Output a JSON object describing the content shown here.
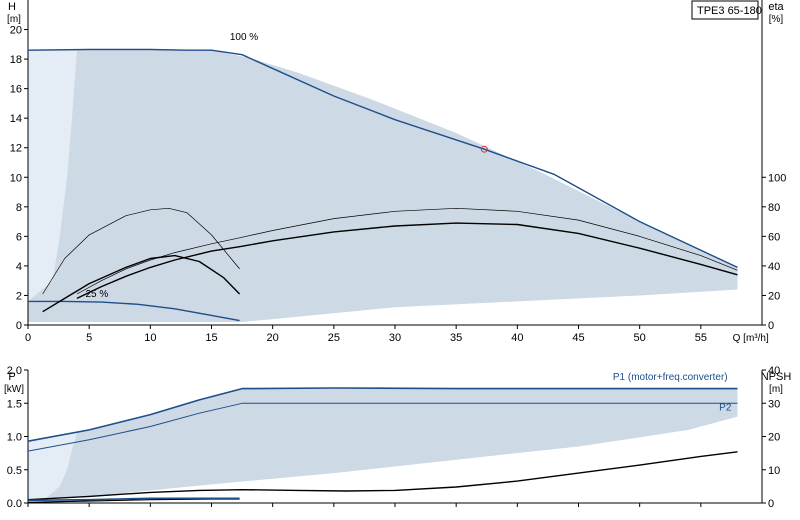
{
  "colors": {
    "operating_area": "#cdd9e4",
    "operating_area_light": "#e4edf5",
    "curve_blue": "#1f4e8a",
    "curve_black": "#000000",
    "axis": "#000000",
    "marker": "#e03030"
  },
  "model_label": "TPE3 65-180",
  "chart_data": [
    {
      "type": "line",
      "id": "top",
      "ylabel_left": "H",
      "yunit_left": "[m]",
      "ylabel_right": "eta",
      "yunit_right": "[%]",
      "xlabel": "Q [m³/h]",
      "xlim": [
        0,
        60
      ],
      "ylim": [
        0,
        22
      ],
      "x_ticks": [
        "0",
        "5",
        "10",
        "15",
        "20",
        "25",
        "30",
        "35",
        "40",
        "45",
        "50",
        "55"
      ],
      "y_ticks_left": [
        "0",
        "2",
        "4",
        "6",
        "8",
        "10",
        "12",
        "14",
        "16",
        "18",
        "20"
      ],
      "y_ticks_right": [
        "0",
        "20",
        "40",
        "60",
        "80",
        "100"
      ],
      "eta_scale_max_at_H": 10,
      "operating_area": [
        [
          0,
          18.6
        ],
        [
          15,
          18.6
        ],
        [
          18,
          18.1
        ],
        [
          22,
          17.1
        ],
        [
          28,
          15.3
        ],
        [
          35,
          13
        ],
        [
          42,
          10.3
        ],
        [
          50,
          7
        ],
        [
          58,
          3.9
        ],
        [
          58,
          2.4
        ],
        [
          50,
          2
        ],
        [
          40,
          1.6
        ],
        [
          30,
          1.2
        ],
        [
          25,
          0.8
        ],
        [
          20,
          0.4
        ],
        [
          17.5,
          0.2
        ],
        [
          0,
          0.2
        ]
      ],
      "light_area": [
        [
          0,
          18.6
        ],
        [
          4,
          18.6
        ],
        [
          3.6,
          14
        ],
        [
          3.2,
          10
        ],
        [
          2.6,
          6
        ],
        [
          2,
          3
        ],
        [
          0,
          1.6
        ]
      ],
      "series": [
        {
          "name": "100 %",
          "color": "blue",
          "x": [
            0,
            5,
            10,
            13,
            15,
            17.5,
            25,
            30,
            37.3,
            43,
            50,
            58
          ],
          "y": [
            18.6,
            18.65,
            18.65,
            18.6,
            18.6,
            18.3,
            15.5,
            13.9,
            11.9,
            10.2,
            7,
            3.9
          ]
        },
        {
          "name": "25 %",
          "color": "blue",
          "x": [
            0,
            3,
            6,
            9,
            12,
            15,
            17.3
          ],
          "y": [
            1.6,
            1.6,
            1.55,
            1.4,
            1.1,
            0.65,
            0.3
          ]
        },
        {
          "name": "",
          "color": "black",
          "width": 1.4,
          "x": [
            1.2,
            3,
            5,
            8,
            10,
            12,
            14,
            16,
            17.3
          ],
          "y": [
            0.9,
            1.8,
            2.8,
            3.9,
            4.5,
            4.7,
            4.3,
            3.2,
            2.1
          ]
        },
        {
          "name": "",
          "color": "black",
          "width": 0.7,
          "x": [
            1.2,
            3,
            5,
            8,
            10,
            11.5,
            13,
            15,
            17.3
          ],
          "y": [
            2.1,
            4.5,
            6.1,
            7.4,
            7.8,
            7.9,
            7.6,
            6.1,
            3.8
          ]
        },
        {
          "name": "",
          "color": "black",
          "width": 1.4,
          "x": [
            4,
            6,
            8,
            10,
            12,
            15,
            17.3,
            20,
            25,
            30,
            35,
            40,
            45,
            50,
            55,
            58
          ],
          "y": [
            1.8,
            2.6,
            3.3,
            3.9,
            4.4,
            5.0,
            5.3,
            5.7,
            6.3,
            6.7,
            6.9,
            6.8,
            6.2,
            5.2,
            4.1,
            3.4
          ]
        },
        {
          "name": "",
          "color": "black",
          "width": 0.7,
          "x": [
            4,
            6,
            8,
            10,
            12,
            15,
            17.3,
            20,
            25,
            30,
            35,
            40,
            45,
            50,
            55,
            58
          ],
          "y": [
            2.1,
            3.0,
            3.8,
            4.4,
            4.9,
            5.5,
            5.9,
            6.4,
            7.2,
            7.7,
            7.9,
            7.7,
            7.1,
            6.0,
            4.7,
            3.7
          ]
        }
      ],
      "marker": {
        "x": 37.3,
        "y": 11.9
      },
      "annotations": [
        {
          "text": "100 %",
          "x": 16.5,
          "y": 19.3
        },
        {
          "text": "25 %",
          "x": 4.7,
          "y": 1.9
        }
      ]
    },
    {
      "type": "line",
      "id": "bottom",
      "ylabel_left": "P",
      "yunit_left": "[kW]",
      "ylabel_right": "NPSH",
      "yunit_right": "[m]",
      "xlim": [
        0,
        60
      ],
      "ylim": [
        0,
        2.0
      ],
      "y_ticks_left": [
        "0.0",
        "0.5",
        "1.0",
        "1.5",
        "2.0"
      ],
      "y_ticks_right": [
        "0",
        "10",
        "20",
        "30",
        "40"
      ],
      "npsh_scale_max_at_P": 2.0,
      "operating_area": [
        [
          0,
          0.93
        ],
        [
          5,
          1.1
        ],
        [
          10,
          1.32
        ],
        [
          14,
          1.55
        ],
        [
          17.5,
          1.72
        ],
        [
          30,
          1.72
        ],
        [
          58,
          1.72
        ],
        [
          58,
          1.3
        ],
        [
          54,
          1.1
        ],
        [
          45,
          0.85
        ],
        [
          35,
          0.65
        ],
        [
          25,
          0.45
        ],
        [
          15,
          0.28
        ],
        [
          5,
          0.1
        ],
        [
          0,
          0.05
        ]
      ],
      "light_area": [
        [
          0,
          0.93
        ],
        [
          4,
          1.05
        ],
        [
          3.6,
          0.8
        ],
        [
          3.2,
          0.5
        ],
        [
          2.6,
          0.25
        ],
        [
          1.5,
          0.08
        ],
        [
          0,
          0.05
        ]
      ],
      "series": [
        {
          "name": "P1 (motor+freq.converter)",
          "color": "blue",
          "width": 1.6,
          "x": [
            0,
            5,
            10,
            14,
            17.5,
            25,
            35,
            45,
            58
          ],
          "y": [
            0.93,
            1.1,
            1.33,
            1.55,
            1.72,
            1.73,
            1.72,
            1.72,
            1.72
          ]
        },
        {
          "name": "P2",
          "color": "blue",
          "width": 1,
          "x": [
            0,
            5,
            10,
            14,
            17.5,
            25,
            35,
            45,
            58
          ],
          "y": [
            0.78,
            0.95,
            1.15,
            1.35,
            1.5,
            1.5,
            1.5,
            1.5,
            1.5
          ]
        },
        {
          "name": "",
          "color": "black",
          "width": 1.4,
          "x": [
            0,
            5,
            10,
            14,
            17.5,
            22,
            26,
            30,
            35,
            40,
            45,
            50,
            55,
            58
          ],
          "y": [
            0.05,
            0.1,
            0.16,
            0.19,
            0.2,
            0.19,
            0.18,
            0.19,
            0.24,
            0.33,
            0.45,
            0.57,
            0.7,
            0.77
          ]
        },
        {
          "name": "",
          "color": "black",
          "width": 1.2,
          "x": [
            0,
            5,
            10,
            15,
            17.3
          ],
          "y": [
            0.01,
            0.03,
            0.05,
            0.06,
            0.06
          ]
        },
        {
          "name": "",
          "color": "blue",
          "width": 1.6,
          "x": [
            0,
            5,
            10,
            15,
            17.3
          ],
          "y": [
            0.04,
            0.05,
            0.07,
            0.07,
            0.07
          ]
        }
      ],
      "labels": [
        {
          "text": "P1 (motor+freq.converter)",
          "x": 52.5,
          "y": 1.85
        },
        {
          "text": "P2",
          "x": 57,
          "y": 1.39
        }
      ]
    }
  ]
}
